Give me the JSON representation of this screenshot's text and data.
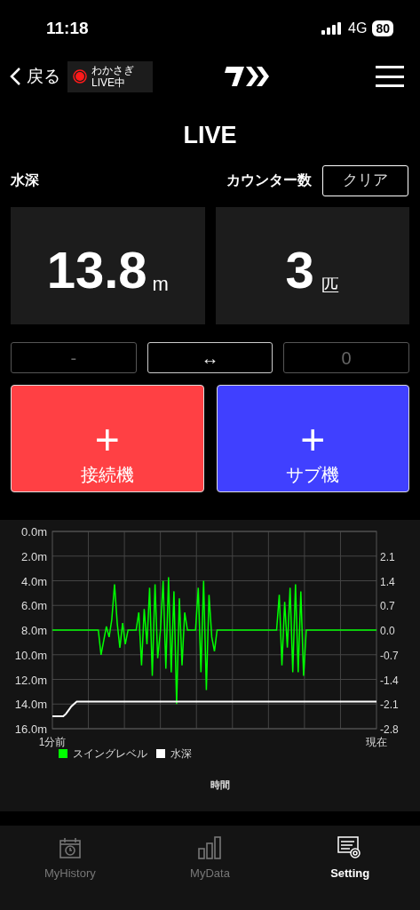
{
  "status_bar": {
    "time": "11:18",
    "network": "4G",
    "battery": "80"
  },
  "header": {
    "back": "戻る",
    "live_badge": {
      "line1": "わかさぎ",
      "line2": "LIVE中"
    }
  },
  "title": "LIVE",
  "depth": {
    "label": "水深",
    "value": "13.8",
    "unit": "m"
  },
  "counter": {
    "label": "カウンター数",
    "clear": "クリア",
    "value": "3",
    "unit": "匹"
  },
  "controls": [
    {
      "label": "-",
      "disabled": true
    },
    {
      "label": "↔",
      "disabled": false
    },
    {
      "label": "0",
      "disabled": true
    }
  ],
  "big_buttons": [
    {
      "symbol": "+",
      "label": "接続機",
      "color": "#ff4044"
    },
    {
      "symbol": "+",
      "label": "サブ機",
      "color": "#4040ff"
    }
  ],
  "chart": {
    "chart_data": {
      "type": "line",
      "xlabel": "時間",
      "categories": [
        "1分前",
        null,
        null,
        null,
        null,
        null,
        null,
        null,
        null,
        null,
        null,
        null,
        null,
        null,
        null,
        null,
        null,
        null,
        null,
        null,
        null,
        null,
        null,
        null,
        null,
        null,
        null,
        null,
        null,
        null,
        null,
        null,
        null,
        null,
        null,
        null,
        null,
        null,
        null,
        null,
        null,
        null,
        null,
        null,
        null,
        null,
        null,
        null,
        null,
        null,
        null,
        null,
        null,
        null,
        null,
        null,
        null,
        null,
        null,
        null,
        null,
        null,
        null,
        null,
        null,
        null,
        null,
        null,
        null,
        null,
        null,
        null,
        null,
        null,
        null,
        null,
        null,
        null,
        null,
        null,
        null,
        null,
        null,
        null,
        null,
        null,
        null,
        null,
        null,
        null,
        null,
        null,
        null,
        null,
        null,
        null,
        null,
        null,
        null,
        null,
        null,
        null,
        null,
        null,
        null,
        null,
        null,
        null,
        null,
        null,
        null,
        null,
        null,
        null,
        null,
        null,
        null,
        null,
        null,
        null,
        "現在"
      ],
      "series": [
        {
          "name": "スイングレベル",
          "color": "#00ff00",
          "axis": "y2",
          "values": [
            0,
            0,
            0,
            0,
            0,
            0,
            0,
            0,
            0,
            0,
            0,
            0,
            0,
            0,
            0,
            0,
            0,
            0,
            -0.7,
            -0.3,
            0.1,
            -0.2,
            0.3,
            1.3,
            0.2,
            -0.5,
            0.2,
            -0.4,
            0,
            0,
            0,
            0,
            0.5,
            -1.0,
            0.6,
            -0.4,
            1.2,
            -1.3,
            1.3,
            -0.8,
            0,
            1.4,
            -1.1,
            1.5,
            -1.2,
            1.1,
            -2.1,
            0.9,
            -1.0,
            0.5,
            0,
            0,
            0,
            0,
            1.2,
            -1.2,
            1.4,
            -1.7,
            1.0,
            -0.2,
            -0.6,
            0,
            0,
            0,
            0,
            0,
            0,
            0,
            0,
            0,
            0,
            0,
            0,
            0,
            0,
            0,
            0,
            0,
            0,
            0,
            0,
            0,
            0,
            0,
            1.0,
            -1.0,
            0.8,
            -0.5,
            1.2,
            -1.2,
            1.3,
            -1.2,
            1.1,
            -1.3,
            0,
            0,
            0,
            0,
            0,
            0,
            0,
            0,
            0,
            0,
            0,
            0,
            0,
            0,
            0,
            0,
            0,
            0,
            0,
            0,
            0,
            0,
            0,
            0,
            0,
            0,
            0
          ]
        },
        {
          "name": "水深",
          "color": "#ffffff",
          "values": [
            15.0,
            15.0,
            15.0,
            15.0,
            15.0,
            14.8,
            14.5,
            14.2,
            14.0,
            13.8,
            13.8,
            13.8,
            13.8,
            13.8,
            13.8,
            13.8,
            13.8,
            13.8,
            13.8,
            13.8,
            13.8,
            13.8,
            13.8,
            13.8,
            13.8,
            13.8,
            13.8,
            13.8,
            13.8,
            13.8,
            13.8,
            13.8,
            13.8,
            13.8,
            13.8,
            13.8,
            13.8,
            13.8,
            13.8,
            13.8,
            13.8,
            13.8,
            13.8,
            13.8,
            13.8,
            13.8,
            13.8,
            13.8,
            13.8,
            13.8,
            13.8,
            13.8,
            13.8,
            13.8,
            13.8,
            13.8,
            13.8,
            13.8,
            13.8,
            13.8,
            13.8,
            13.8,
            13.8,
            13.8,
            13.8,
            13.8,
            13.8,
            13.8,
            13.8,
            13.8,
            13.8,
            13.8,
            13.8,
            13.8,
            13.8,
            13.8,
            13.8,
            13.8,
            13.8,
            13.8,
            13.8,
            13.8,
            13.8,
            13.8,
            13.8,
            13.8,
            13.8,
            13.8,
            13.8,
            13.8,
            13.8,
            13.8,
            13.8,
            13.8,
            13.8,
            13.8,
            13.8,
            13.8,
            13.8,
            13.8,
            13.8,
            13.8,
            13.8,
            13.8,
            13.8,
            13.8,
            13.8,
            13.8,
            13.8,
            13.8,
            13.8,
            13.8,
            13.8,
            13.8,
            13.8,
            13.8,
            13.8,
            13.8,
            13.8,
            13.8,
            13.8
          ]
        }
      ],
      "ylim": [
        16,
        0
      ],
      "yticks": [
        {
          "value": 0,
          "label": "0.0m"
        },
        {
          "value": 2,
          "label": "2.0m"
        },
        {
          "value": 4,
          "label": "4.0m"
        },
        {
          "value": 6,
          "label": "6.0m"
        },
        {
          "value": 8,
          "label": "8.0m"
        },
        {
          "value": 10,
          "label": "10.0m"
        },
        {
          "value": 12,
          "label": "12.0m"
        },
        {
          "value": 14,
          "label": "14.0m"
        },
        {
          "value": 16,
          "label": "16.0m"
        }
      ],
      "y2lim": [
        -2.8,
        2.8
      ],
      "grid": true,
      "legend": true,
      "y2ticks": [
        2.1,
        1.4,
        0.7,
        {
          "value": 0,
          "label": "0.0"
        },
        -0.7,
        -1.4,
        -2.1,
        -2.8
      ]
    }
  },
  "tabs": [
    {
      "label": "MyHistory",
      "selected": false
    },
    {
      "label": "MyData",
      "selected": false
    },
    {
      "label": "Setting",
      "selected": true
    }
  ]
}
